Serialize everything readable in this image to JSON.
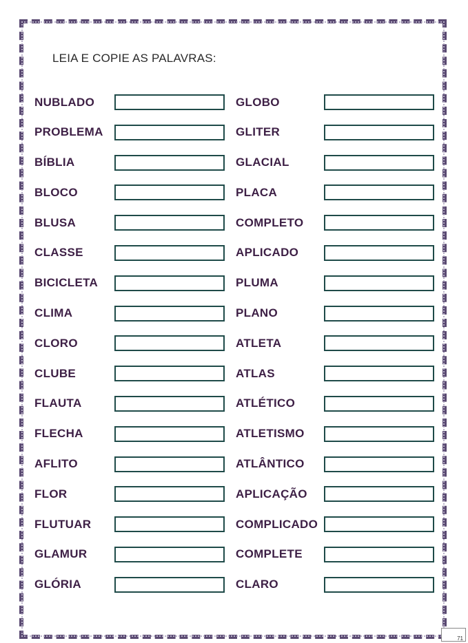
{
  "instruction": "LEIA E COPIE AS PALAVRAS:",
  "colors": {
    "word_text": "#3d1f45",
    "box_border": "#1e4a48",
    "frame": "#5a4a72"
  },
  "left_words": [
    "NUBLADO",
    "PROBLEMA",
    "BÍBLIA",
    "BLOCO",
    "BLUSA",
    "CLASSE",
    "BICICLETA",
    "CLIMA",
    "CLORO",
    "CLUBE",
    "FLAUTA",
    "FLECHA",
    "AFLITO",
    "FLOR",
    "FLUTUAR",
    "GLAMUR",
    "GLÓRIA"
  ],
  "right_words": [
    "GLOBO",
    "GLITER",
    "GLACIAL",
    "PLACA",
    "COMPLETO",
    "APLICADO",
    "PLUMA",
    "PLANO",
    "ATLETA",
    "ATLAS",
    "ATLÉTICO",
    "ATLETISMO",
    "ATLÂNTICO",
    "APLICAÇÃO",
    "COMPLICADO",
    "COMPLETE",
    "CLARO"
  ],
  "page_number": "71"
}
